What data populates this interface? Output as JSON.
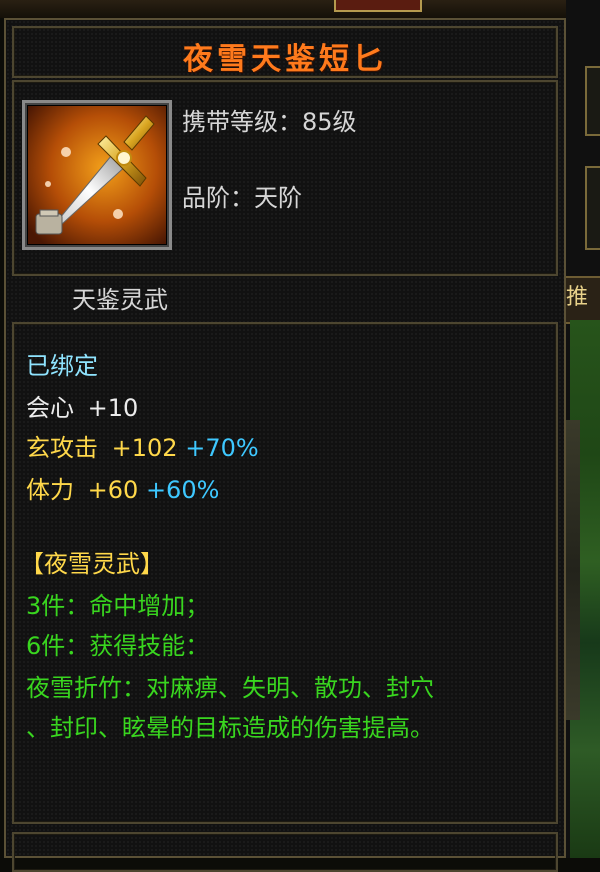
{
  "item": {
    "name": "夜雪天鉴短匕",
    "level_label": "携带等级：",
    "level_value": "85级",
    "grade_label": "品阶：",
    "grade_value": "天阶",
    "category": "天鉴灵武",
    "icon": "golden-dagger-icon"
  },
  "stats": {
    "bound": "已绑定",
    "crit_label": "会心",
    "crit_value": "+10",
    "xuan_label": "玄攻击",
    "xuan_value": "+102",
    "xuan_pct": "+70%",
    "stamina_label": "体力",
    "stamina_value": "+60",
    "stamina_pct": "+60%"
  },
  "set": {
    "name": "【夜雪灵武】",
    "bonus3": "3件：命中增加；",
    "bonus6": "6件：获得技能：",
    "skill_line1": "夜雪折竹：对麻痹、失明、散功、封穴",
    "skill_line2": "、封印、眩晕的目标造成的伤害提高。"
  },
  "side": {
    "banner_text": "推"
  },
  "colors": {
    "title": "#ff7a1c",
    "set_text": "#39d61f",
    "attr_yellow": "#ffd84a",
    "bonus_cyan": "#3ec8ff",
    "bound_cyan": "#8fe4ff"
  }
}
